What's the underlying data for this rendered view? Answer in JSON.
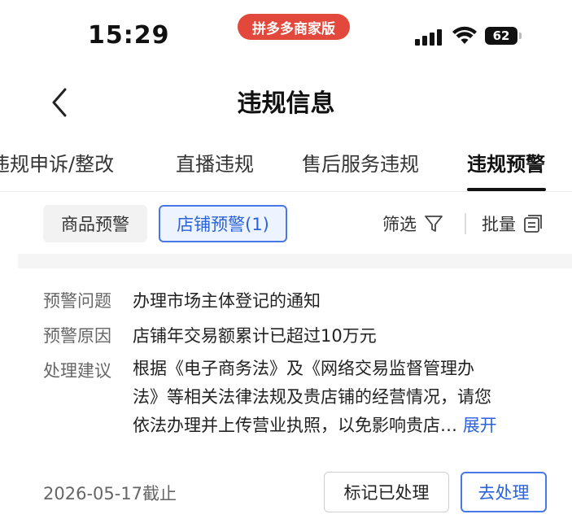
{
  "status_bar": {
    "time": "15:29",
    "app_badge": "拼多多商家版",
    "battery": "62"
  },
  "nav": {
    "title": "违规信息",
    "back_icon": "chevron-left-icon"
  },
  "tabs": [
    {
      "label": "违规申诉/整改",
      "active": false
    },
    {
      "label": "直播违规",
      "active": false
    },
    {
      "label": "售后服务违规",
      "active": false
    },
    {
      "label": "违规预警",
      "active": true
    }
  ],
  "filters": {
    "goods_chip": "商品预警",
    "shop_chip": "店铺预警(1)",
    "filter_label": "筛选",
    "filter_icon": "funnel-icon",
    "batch_label": "批量",
    "batch_icon": "batch-list-icon"
  },
  "warning": {
    "issue_label": "预警问题",
    "issue_value": "办理市场主体登记的通知",
    "reason_label": "预警原因",
    "reason_value": "店铺年交易额累计已超过10万元",
    "advice_label": "处理建议",
    "advice_lines": [
      "根据《电子商务法》及《网络交易监督管理办",
      "法》等相关法律法规及贵店铺的经营情况，请您",
      "依法办理并上传营业执照，以免影响贵店…"
    ],
    "expand_label": "展开",
    "deadline": "2026-05-17截止",
    "mark_button": "标记已处理",
    "handle_button": "去处理"
  },
  "colors": {
    "accent_blue": "#2b62d9",
    "badge_red": "#e2483b"
  }
}
